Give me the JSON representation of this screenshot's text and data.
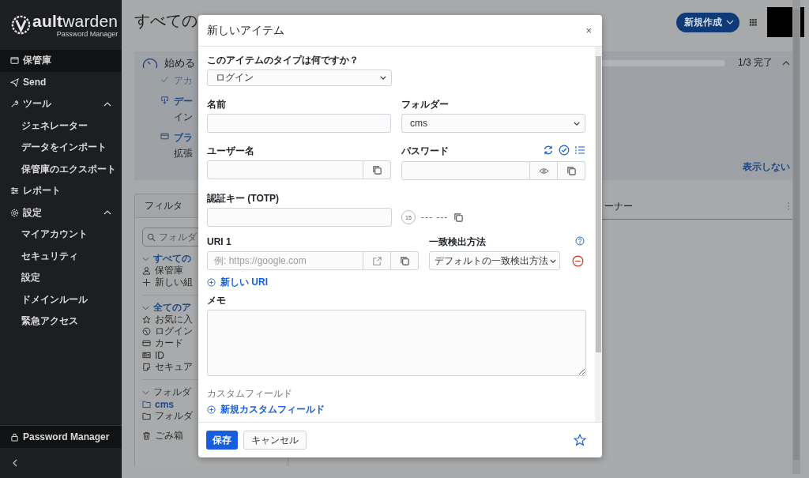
{
  "sidebar": {
    "logo": {
      "wordmark": "**ault**warden",
      "subtitle": "Password Manager"
    },
    "nav": [
      {
        "label": "保管庫",
        "kind": "vault",
        "selected": true
      },
      {
        "label": "Send",
        "kind": "send",
        "selected": false
      },
      {
        "label": "ツール",
        "kind": "wrench",
        "selected": false,
        "expanded": true,
        "children": [
          {
            "label": "ジェネレーター",
            "selected": false
          },
          {
            "label": "データをインポート",
            "selected": false
          },
          {
            "label": "保管庫のエクスポート",
            "selected": false
          }
        ]
      },
      {
        "label": "レポート",
        "kind": "sliders",
        "selected": false
      },
      {
        "label": "設定",
        "kind": "gear",
        "selected": false,
        "expanded": true,
        "children": [
          {
            "label": "マイアカウント",
            "selected": false
          },
          {
            "label": "セキュリティ",
            "selected": false
          },
          {
            "label": "設定",
            "selected": false
          },
          {
            "label": "ドメインルール",
            "selected": false
          },
          {
            "label": "緊急アクセス",
            "selected": false
          }
        ]
      }
    ],
    "footer": "Password Manager"
  },
  "header": {
    "title": "すべての",
    "new_button": "新規作成"
  },
  "onboarding": {
    "title": "始める",
    "progress": "1/3 完了",
    "expanded": true,
    "tasks": [
      {
        "title": "アカ",
        "done": true
      },
      {
        "title": "デー",
        "subtitle": "イン",
        "done": false,
        "kind": "download"
      },
      {
        "title": "ブラ",
        "subtitle": "拡張",
        "done": false,
        "kind": "browser"
      }
    ],
    "dismiss": "表示しない"
  },
  "filter": {
    "title": "フィルタ",
    "search_placeholder": "フォルダ",
    "groups": [
      {
        "label": "すべての",
        "selected": true,
        "expanded": true,
        "children": [
          {
            "label": "保管庫",
            "kind": "person",
            "selected": false
          },
          {
            "label": "新しい組",
            "kind": "plus",
            "selected": false
          }
        ]
      },
      {
        "label": "全てのア",
        "selected": true,
        "expanded": true,
        "children": [
          {
            "label": "お気に入",
            "kind": "star",
            "selected": false
          },
          {
            "label": "ログイン",
            "kind": "globe",
            "selected": false
          },
          {
            "label": "カード",
            "kind": "card",
            "selected": false
          },
          {
            "label": "ID",
            "kind": "idcard",
            "selected": false
          },
          {
            "label": "セキュア",
            "kind": "note",
            "selected": false
          }
        ]
      },
      {
        "label": "フォルダ",
        "selected": false,
        "expanded": true,
        "children": [
          {
            "label": "cms",
            "kind": "folder",
            "selected": true
          },
          {
            "label": "フォルダ",
            "kind": "folder",
            "selected": false
          }
        ]
      }
    ],
    "trash": "ごみ箱"
  },
  "table": {
    "columns": [
      "ーナー"
    ]
  },
  "dialog": {
    "title": "新しいアイテム",
    "close": "×",
    "type_label": "このアイテムのタイプは何ですか？",
    "type_value": "ログイン",
    "name_label": "名前",
    "folder_label": "フォルダー",
    "folder_value": "cms",
    "username_label": "ユーザー名",
    "password_label": "パスワード",
    "totp_label": "認証キー (TOTP)",
    "totp_timer": "15",
    "totp_code": "--- ---",
    "uri_label": "URI 1",
    "uri_placeholder": "例: https://google.com",
    "match_label": "一致検出方法",
    "match_value": "デフォルトの一致検出方法",
    "new_uri": "新しい URI",
    "notes_label": "メモ",
    "custom_fields_label": "カスタムフィールド",
    "new_custom_field": "新規カスタムフィールド",
    "save": "保存",
    "cancel": "キャンセル",
    "favorite": false
  }
}
